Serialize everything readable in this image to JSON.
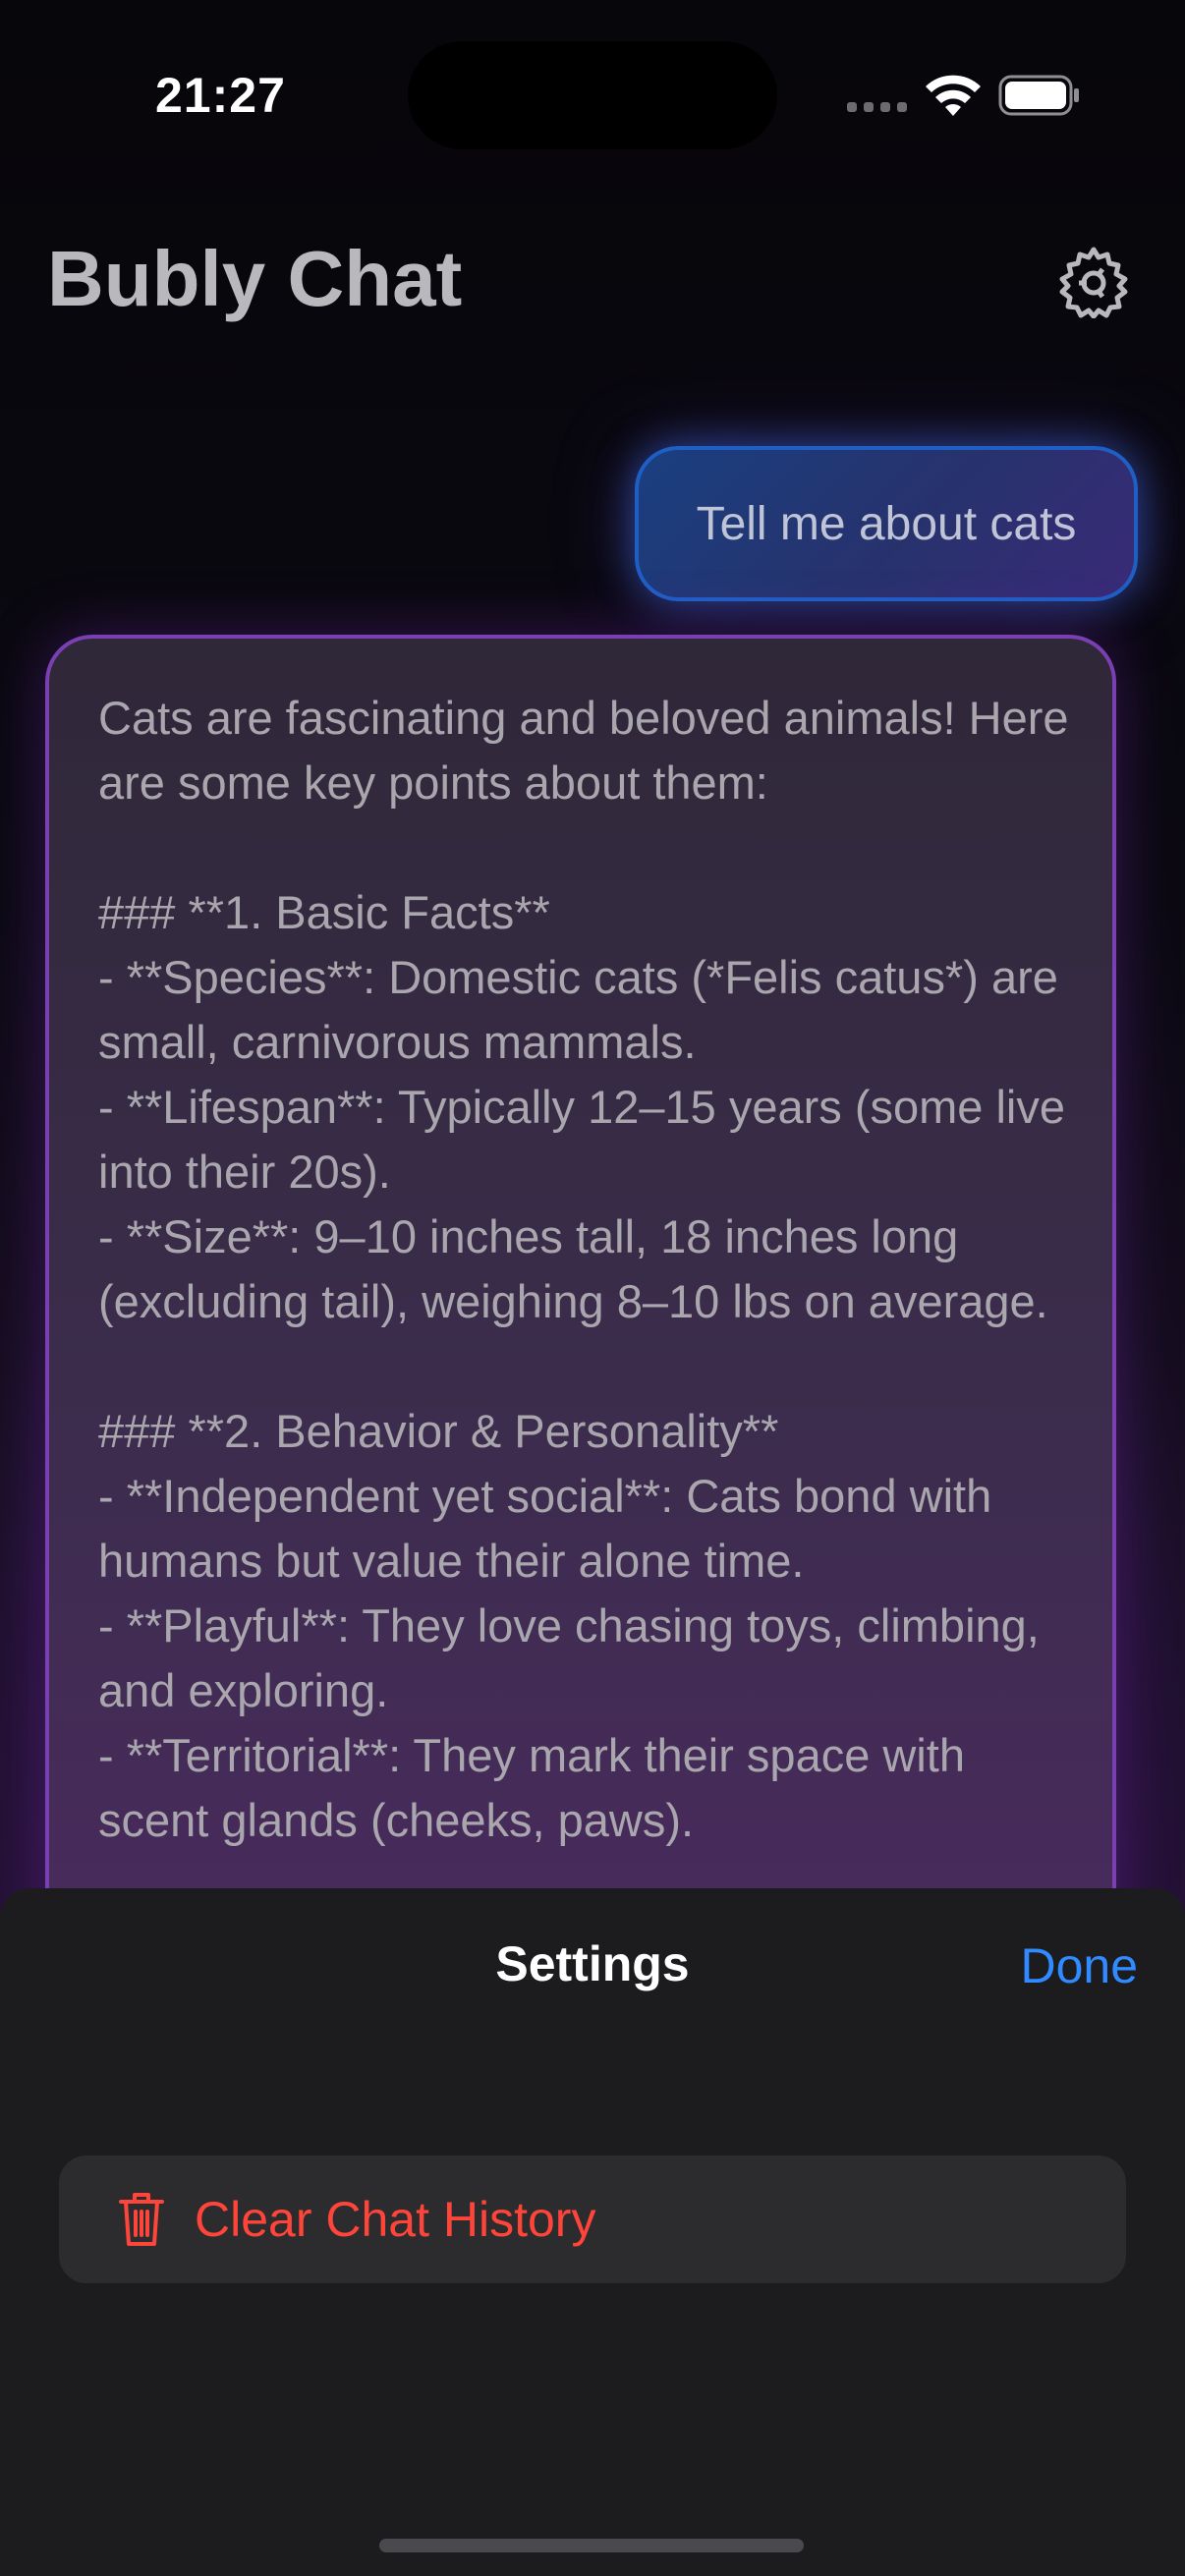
{
  "status_bar": {
    "time": "21:27"
  },
  "header": {
    "title": "Bubly Chat",
    "settings_icon": "gear-icon"
  },
  "chat": {
    "user_message": "Tell me about cats",
    "assistant_message": "Cats are fascinating and beloved animals! Here are some key points about them:\n\n### **1. Basic Facts**\n- **Species**: Domestic cats (*Felis catus*) are small, carnivorous mammals.\n- **Lifespan**: Typically 12–15 years (some live into their 20s).\n- **Size**: 9–10 inches tall, 18 inches long (excluding tail), weighing 8–10 lbs on average.\n\n### **2. Behavior & Personality**\n- **Independent yet social**: Cats bond with humans but value their alone time.\n- **Playful**: They love chasing toys, climbing, and exploring.\n- **Territorial**: They mark their space with scent glands (cheeks, paws)."
  },
  "settings_sheet": {
    "title": "Settings",
    "done_label": "Done",
    "clear_history_label": "Clear Chat History",
    "clear_history_icon": "trash-icon"
  },
  "colors": {
    "accent_blue": "#2f8bff",
    "destructive_red": "#ff453a",
    "user_bubble_border": "#1f5fc4",
    "assistant_bubble_border": "#7a3fb0"
  }
}
